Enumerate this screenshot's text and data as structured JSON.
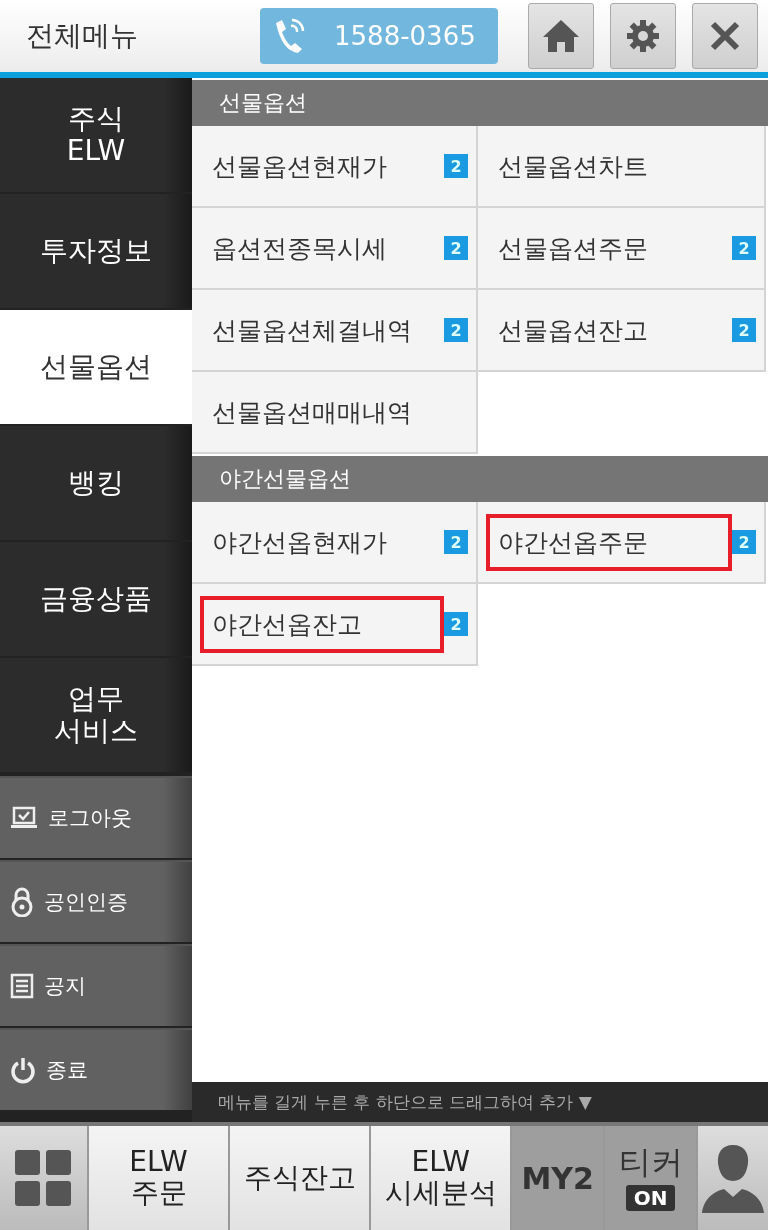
{
  "header": {
    "title": "전체메뉴",
    "phone": "1588-0365",
    "buttons": [
      {
        "kind": "home"
      },
      {
        "kind": "settings"
      },
      {
        "kind": "close"
      }
    ]
  },
  "sidebar": {
    "items": [
      {
        "label": "주식\nELW",
        "selected": false,
        "kind": "main"
      },
      {
        "label": "투자정보",
        "selected": false,
        "kind": "main"
      },
      {
        "label": "선물옵션",
        "selected": true,
        "kind": "main"
      },
      {
        "label": "뱅킹",
        "selected": false,
        "kind": "main"
      },
      {
        "label": "금융상품",
        "selected": false,
        "kind": "main"
      },
      {
        "label": "업무\n서비스",
        "selected": false,
        "kind": "main"
      },
      {
        "label": "로그아웃",
        "selected": false,
        "kind": "logout"
      },
      {
        "label": "공인인증",
        "selected": false,
        "kind": "cert"
      },
      {
        "label": "공지",
        "selected": false,
        "kind": "notice"
      },
      {
        "label": "종료",
        "selected": false,
        "kind": "power"
      }
    ]
  },
  "sections": [
    {
      "title": "선물옵션",
      "items": [
        {
          "label": "선물옵션현재가",
          "badge": "2",
          "highlighted": false
        },
        {
          "label": "선물옵션차트",
          "highlighted": false
        },
        {
          "label": "옵션전종목시세",
          "badge": "2",
          "highlighted": false
        },
        {
          "label": "선물옵션주문",
          "badge": "2",
          "highlighted": false
        },
        {
          "label": "선물옵션체결내역",
          "badge": "2",
          "highlighted": false
        },
        {
          "label": "선물옵션잔고",
          "badge": "2",
          "highlighted": false
        },
        {
          "label": "선물옵션매매내역",
          "highlighted": false
        }
      ]
    },
    {
      "title": "야간선물옵션",
      "items": [
        {
          "label": "야간선옵현재가",
          "badge": "2",
          "highlighted": false
        },
        {
          "label": "야간선옵주문",
          "badge": "2",
          "highlighted": true
        },
        {
          "label": "야간선옵잔고",
          "badge": "2",
          "highlighted": true
        }
      ]
    }
  ],
  "hint": "메뉴를 길게 누른 후 하단으로 드래그하여 추가 ▼",
  "dock": [
    {
      "kind": "grid"
    },
    {
      "kind": "text",
      "label": "ELW\n주문"
    },
    {
      "kind": "text",
      "label": "주식잔고"
    },
    {
      "kind": "text",
      "label": "ELW\n시세분석"
    },
    {
      "kind": "my",
      "label": "MY2"
    },
    {
      "kind": "ticker",
      "label": "티커",
      "badge": "ON",
      "on": true
    },
    {
      "kind": "profile"
    }
  ]
}
